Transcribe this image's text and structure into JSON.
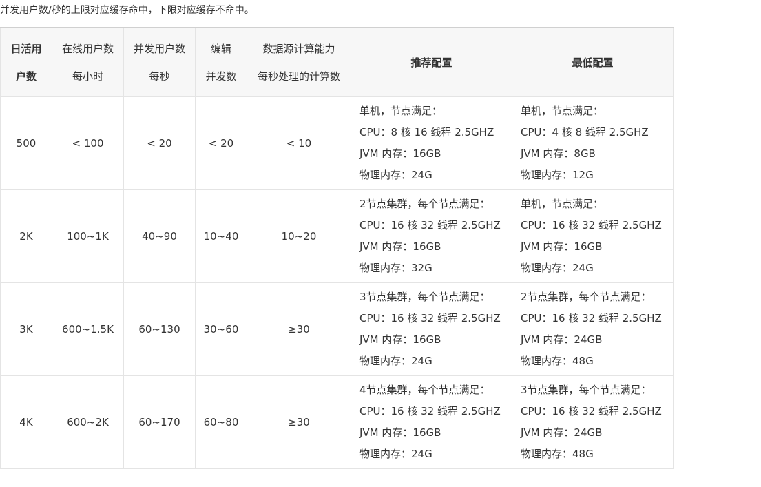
{
  "intro_text": "并发用户数/秒的上限对应缓存命中，下限对应缓存不命中。",
  "table": {
    "headers": [
      {
        "lines": [
          "日活用",
          "户数"
        ],
        "bold": true
      },
      {
        "lines": [
          "在线用户数",
          "每小时"
        ],
        "bold": false
      },
      {
        "lines": [
          "并发用户数",
          "每秒"
        ],
        "bold": false
      },
      {
        "lines": [
          "编辑",
          "并发数"
        ],
        "bold": false
      },
      {
        "lines": [
          "数据源计算能力",
          "每秒处理的计算数"
        ],
        "bold": false
      },
      {
        "lines": [
          "推荐配置"
        ],
        "bold": true
      },
      {
        "lines": [
          "最低配置"
        ],
        "bold": true
      }
    ],
    "rows": [
      {
        "daily_users": "500",
        "online_per_hour": "< 100",
        "concurrent_per_sec": "< 20",
        "edit_concurrency": "< 20",
        "datasource_capacity": "< 10",
        "recommended": [
          "单机，节点满足：",
          "CPU：8 核 16 线程 2.5GHZ",
          "JVM 内存：16GB",
          "物理内存：24G"
        ],
        "minimum": [
          "单机，节点满足：",
          "CPU：4 核 8 线程 2.5GHZ",
          "JVM 内存：8GB",
          "物理内存：12G"
        ]
      },
      {
        "daily_users": "2K",
        "online_per_hour": "100~1K",
        "concurrent_per_sec": "40~90",
        "edit_concurrency": "10~40",
        "datasource_capacity": "10~20",
        "recommended": [
          "2节点集群，每个节点满足：",
          "CPU：16 核 32 线程 2.5GHZ",
          "JVM 内存：16GB",
          "物理内存：32G"
        ],
        "minimum": [
          "单机，节点满足：",
          "CPU：16 核 32 线程 2.5GHZ",
          "JVM 内存：16GB",
          "物理内存：24G"
        ]
      },
      {
        "daily_users": "3K",
        "online_per_hour": "600~1.5K",
        "concurrent_per_sec": "60~130",
        "edit_concurrency": "30~60",
        "datasource_capacity": "≥30",
        "recommended": [
          "3节点集群，每个节点满足：",
          "CPU：16 核 32 线程 2.5GHZ",
          "JVM 内存：16GB",
          "物理内存：24G"
        ],
        "minimum": [
          "2节点集群，每个节点满足：",
          "CPU：16 核 32 线程 2.5GHZ",
          "JVM 内存：24GB",
          "物理内存：48G"
        ]
      },
      {
        "daily_users": "4K",
        "online_per_hour": "600~2K",
        "concurrent_per_sec": "60~170",
        "edit_concurrency": "60~80",
        "datasource_capacity": "≥30",
        "recommended": [
          "4节点集群，每个节点满足：",
          "CPU：16 核 32 线程 2.5GHZ",
          "JVM 内存：16GB",
          "物理内存：24G"
        ],
        "minimum": [
          "3节点集群，每个节点满足：",
          "CPU：16 核 32 线程 2.5GHZ",
          "JVM 内存：24GB",
          "物理内存：48G"
        ]
      }
    ]
  }
}
